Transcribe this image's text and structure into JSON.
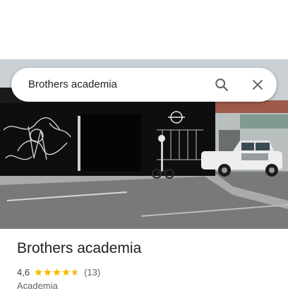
{
  "search": {
    "query": "Brothers academia"
  },
  "place": {
    "name": "Brothers academia",
    "rating": "4,6",
    "rating_value": 4.6,
    "rating_max": 5,
    "review_count": "(13)",
    "category": "Academia"
  },
  "icons": {
    "search": "search-icon",
    "close": "close-icon",
    "star": "star-icon"
  },
  "colors": {
    "star": "#fbbc04",
    "star_empty": "#dadce0",
    "text_primary": "#202124",
    "text_secondary": "#5f6368",
    "icon": "#5f6368"
  }
}
